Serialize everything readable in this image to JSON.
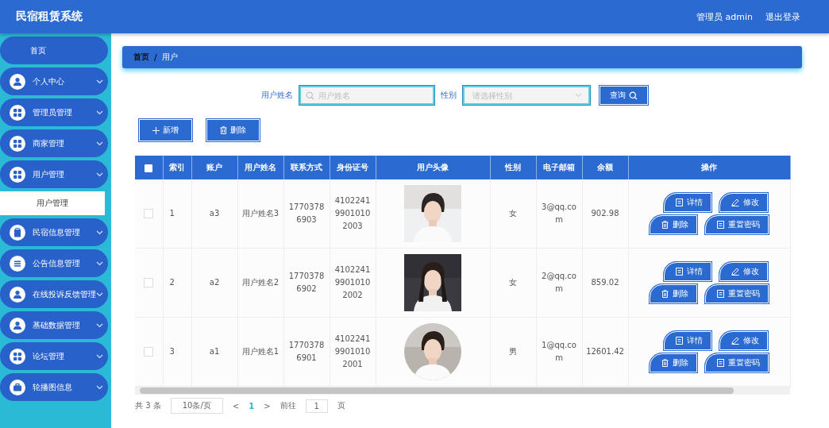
{
  "header": {
    "title": "民宿租赁系统",
    "user": "管理员 admin",
    "logout": "退出登录"
  },
  "sidebar": {
    "items": [
      {
        "label": "首页"
      },
      {
        "label": "个人中心"
      },
      {
        "label": "管理员管理"
      },
      {
        "label": "商家管理"
      },
      {
        "label": "用户管理",
        "children": [
          {
            "label": "用户管理",
            "selected": true
          }
        ]
      },
      {
        "label": "民宿信息管理"
      },
      {
        "label": "公告信息管理"
      },
      {
        "label": "在线投诉反馈管理"
      },
      {
        "label": "基础数据管理"
      },
      {
        "label": "论坛管理"
      },
      {
        "label": "轮播图信息"
      }
    ]
  },
  "breadcrumb": {
    "items": [
      "首页",
      "用户"
    ],
    "separator": "/"
  },
  "search": {
    "name_label": "用户姓名",
    "name_placeholder": "用户姓名",
    "gender_label": "性别",
    "gender_placeholder": "请选择性别",
    "button": "查询"
  },
  "actions": [
    "新增",
    "删除"
  ],
  "table": {
    "select_all_checked": false,
    "columns": [
      "索引",
      "账户",
      "用户姓名",
      "联系方式",
      "身份证号",
      "用户头像",
      "性别",
      "电子邮箱",
      "余额",
      "操作"
    ],
    "rows": [
      {
        "checked": false,
        "cells": [
          "1",
          "a3",
          "用户姓名3",
          "17703786903",
          "410224199010102003"
        ],
        "gender": "女",
        "email": "3@qq.com",
        "balance": "902.98",
        "avatar_round": false,
        "buttons": [
          "详情",
          "修改",
          "删除",
          "重置密码"
        ]
      },
      {
        "checked": false,
        "cells": [
          "2",
          "a2",
          "用户姓名2",
          "17703786902",
          "410224199010102002"
        ],
        "gender": "女",
        "email": "2@qq.com",
        "balance": "859.02",
        "avatar_round": false,
        "buttons": [
          "详情",
          "修改",
          "删除",
          "重置密码"
        ]
      },
      {
        "checked": false,
        "cells": [
          "3",
          "a1",
          "用户姓名1",
          "17703786901",
          "410224199010102001"
        ],
        "gender": "男",
        "email": "1@qq.com",
        "balance": "12601.42",
        "avatar_round": true,
        "buttons": [
          "详情",
          "修改",
          "删除",
          "重置密码"
        ]
      }
    ]
  },
  "pagination": {
    "total": "共 3 条",
    "size": "10条/页",
    "prev": "<",
    "page": "1",
    "next": ">",
    "goto": "前往",
    "goto_value": "1",
    "unit": "页"
  }
}
